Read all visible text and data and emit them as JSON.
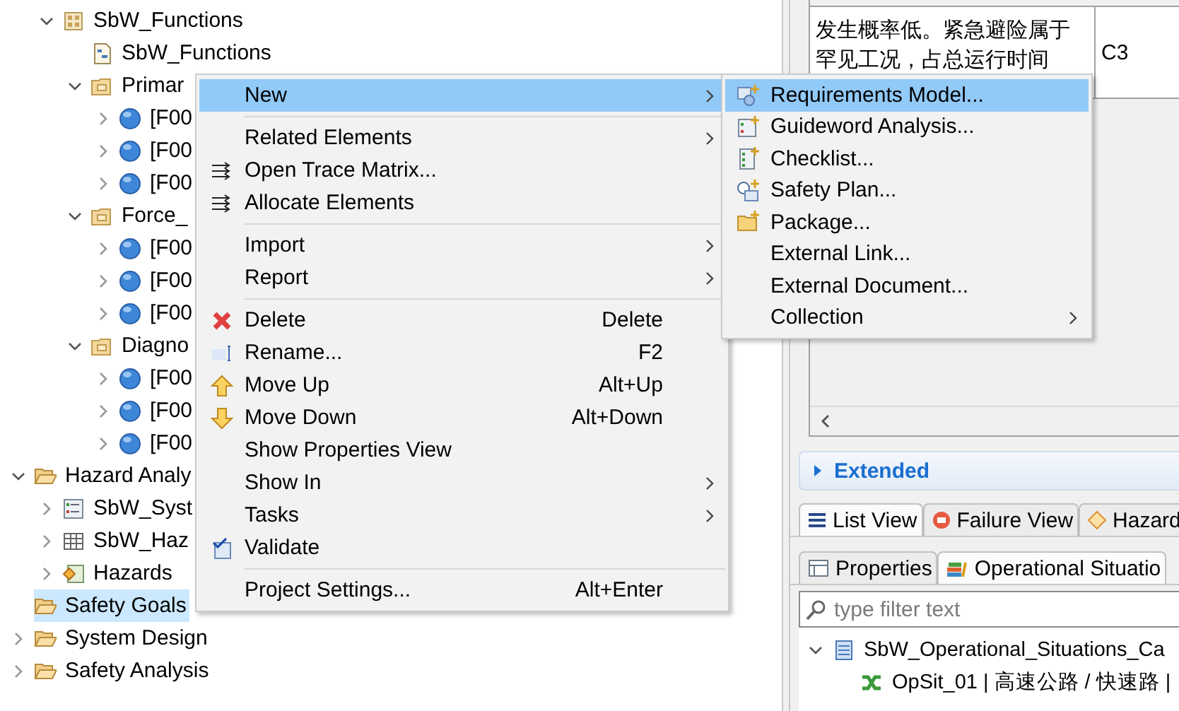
{
  "navigator": {
    "function_items": [
      {
        "label": "SbW_Functions",
        "kind": "package",
        "expanded": true,
        "selected": false,
        "children": [
          {
            "label": "SbW_Functions",
            "kind": "model",
            "selected": false
          },
          {
            "label": "Primar",
            "kind": "group",
            "expanded": true,
            "selected": false,
            "children": [
              {
                "label": "[F00",
                "kind": "function",
                "expanded": false,
                "selected": false
              },
              {
                "label": "[F00",
                "kind": "function",
                "expanded": false,
                "selected": false
              },
              {
                "label": "[F00",
                "kind": "function",
                "expanded": false,
                "selected": false
              }
            ]
          },
          {
            "label": "Force_",
            "kind": "group",
            "expanded": true,
            "selected": false,
            "children": [
              {
                "label": "[F00",
                "kind": "function",
                "expanded": false,
                "selected": false
              },
              {
                "label": "[F00",
                "kind": "function",
                "expanded": false,
                "selected": false
              },
              {
                "label": "[F00",
                "kind": "function",
                "expanded": false,
                "selected": false
              }
            ]
          },
          {
            "label": "Diagno",
            "kind": "group",
            "expanded": true,
            "selected": false,
            "children": [
              {
                "label": "[F00",
                "kind": "function",
                "expanded": false,
                "selected": false
              },
              {
                "label": "[F00",
                "kind": "function",
                "expanded": false,
                "selected": false
              },
              {
                "label": "[F00",
                "kind": "function",
                "expanded": false,
                "selected": false
              }
            ]
          }
        ]
      }
    ],
    "categories": [
      {
        "label": "Hazard Analy",
        "kind": "folder",
        "expanded": true,
        "selected": false,
        "children": [
          {
            "label": "SbW_Syst",
            "kind": "list",
            "expanded": false,
            "selected": false
          },
          {
            "label": "SbW_Haz",
            "kind": "table",
            "expanded": false,
            "selected": false
          },
          {
            "label": "Hazards",
            "kind": "hazards",
            "expanded": false,
            "selected": false
          }
        ]
      },
      {
        "label": "Safety Goals",
        "kind": "folder",
        "selected": true
      },
      {
        "label": "System Design",
        "kind": "folder",
        "expanded": false,
        "selected": false
      },
      {
        "label": "Safety Analysis",
        "kind": "folder",
        "expanded": false,
        "selected": false
      }
    ]
  },
  "context_menu": {
    "groups": [
      [
        {
          "label": "New",
          "submenu": true,
          "selected": true
        }
      ],
      [
        {
          "label": "Related Elements",
          "submenu": true,
          "selected": false
        },
        {
          "label": "Open Trace Matrix...",
          "kind": "trace",
          "selected": false
        },
        {
          "label": "Allocate Elements",
          "kind": "trace",
          "selected": false
        }
      ],
      [
        {
          "label": "Import",
          "submenu": true,
          "selected": false
        },
        {
          "label": "Report",
          "submenu": true,
          "selected": false
        }
      ],
      [
        {
          "label": "Delete",
          "kind": "delete",
          "shortcut": "Delete",
          "selected": false
        },
        {
          "label": "Rename...",
          "kind": "rename",
          "shortcut": "F2",
          "selected": false
        },
        {
          "label": "Move Up",
          "kind": "up",
          "shortcut": "Alt+Up",
          "selected": false
        },
        {
          "label": "Move Down",
          "kind": "down",
          "shortcut": "Alt+Down",
          "selected": false
        },
        {
          "label": "Show Properties View",
          "selected": false
        },
        {
          "label": "Show In",
          "submenu": true,
          "selected": false
        },
        {
          "label": "Tasks",
          "submenu": true,
          "selected": false
        },
        {
          "label": "Validate",
          "kind": "validate",
          "selected": false
        }
      ],
      [
        {
          "label": "Project Settings...",
          "shortcut": "Alt+Enter",
          "selected": false
        }
      ]
    ]
  },
  "new_submenu": {
    "items": [
      {
        "label": "Requirements Model...",
        "kind": "requirements",
        "selected": true
      },
      {
        "label": "Guideword Analysis...",
        "kind": "list",
        "selected": false
      },
      {
        "label": "Checklist...",
        "kind": "checklist",
        "selected": false
      },
      {
        "label": "Safety Plan...",
        "kind": "plan",
        "selected": false
      },
      {
        "label": "Package...",
        "kind": "package",
        "selected": false
      },
      {
        "label": "External Link...",
        "selected": false
      },
      {
        "label": "External Document...",
        "selected": false
      },
      {
        "label": "Collection",
        "submenu": true,
        "selected": false
      }
    ]
  },
  "table": {
    "rows": [
      {
        "description": "发生概率低。紧急避险属于罕见工况，占总运行时间",
        "class": "C3"
      }
    ]
  },
  "extended_section": {
    "title": "Extended",
    "expanded": false
  },
  "view_tabs": [
    {
      "label": "List View",
      "kind": "list",
      "selected": true
    },
    {
      "label": "Failure View",
      "kind": "failure",
      "selected": false
    },
    {
      "label": "Hazard",
      "kind": "hazard",
      "selected": false
    }
  ],
  "bottom_tabs": [
    {
      "label": "Properties",
      "kind": "properties",
      "selected": false
    },
    {
      "label": "Operational Situatio",
      "kind": "situations",
      "selected": true
    }
  ],
  "filter": {
    "placeholder": "type filter text"
  },
  "situations_tree": [
    {
      "label": "SbW_Operational_Situations_Ca",
      "kind": "catalog",
      "expanded": true,
      "children": [
        {
          "label": "OpSit_01 | 高速公路 / 快速路 |",
          "kind": "situation"
        }
      ]
    }
  ]
}
